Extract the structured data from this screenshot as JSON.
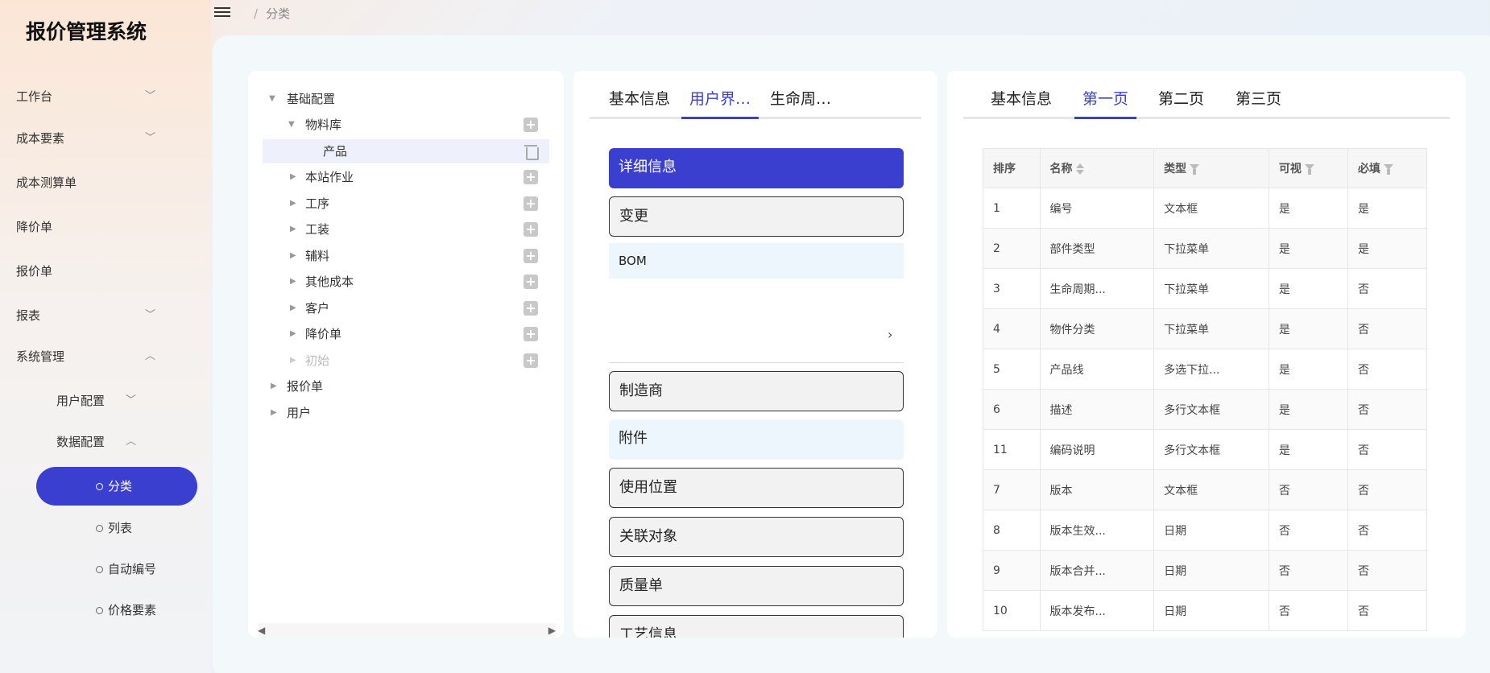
{
  "app": {
    "title": "报价管理系统"
  },
  "breadcrumb": {
    "separator": "/",
    "current": "分类"
  },
  "sidebar": {
    "items": [
      {
        "label": "工作台",
        "chevron": "down"
      },
      {
        "label": "成本要素",
        "chevron": "down"
      },
      {
        "label": "成本测算单"
      },
      {
        "label": "降价单"
      },
      {
        "label": "报价单"
      },
      {
        "label": "报表",
        "chevron": "down"
      },
      {
        "label": "系统管理",
        "chevron": "up"
      }
    ],
    "sub": [
      {
        "label": "用户配置",
        "chevron": "down"
      },
      {
        "label": "数据配置",
        "chevron": "up"
      }
    ],
    "leaves": [
      {
        "label": "分类",
        "active": true
      },
      {
        "label": "列表"
      },
      {
        "label": "自动编号"
      },
      {
        "label": "价格要素"
      }
    ]
  },
  "tree": {
    "nodes": [
      {
        "label": "基础配置",
        "level": 0,
        "arrow": "down"
      },
      {
        "label": "物料库",
        "level": 1,
        "arrow": "down",
        "add": true
      },
      {
        "label": "产品",
        "level": 2,
        "selected": true,
        "trash": true
      },
      {
        "label": "本站作业",
        "level": 1,
        "arrow": "right",
        "add": true
      },
      {
        "label": "工序",
        "level": 1,
        "arrow": "right",
        "add": true
      },
      {
        "label": "工装",
        "level": 1,
        "arrow": "right",
        "add": true
      },
      {
        "label": "辅料",
        "level": 1,
        "arrow": "right",
        "add": true
      },
      {
        "label": "其他成本",
        "level": 1,
        "arrow": "right",
        "add": true
      },
      {
        "label": "客户",
        "level": 1,
        "arrow": "right",
        "add": true
      },
      {
        "label": "降价单",
        "level": 1,
        "arrow": "right",
        "add": true
      },
      {
        "label": "初始",
        "level": 1,
        "arrow": "right",
        "add": true,
        "disabled": true
      },
      {
        "label": "报价单",
        "level": 0,
        "arrow": "right"
      },
      {
        "label": "用户",
        "level": 0,
        "arrow": "right"
      }
    ]
  },
  "middle": {
    "tabs": [
      "基本信息",
      "用户界…",
      "生命周…"
    ],
    "active_tab": 1,
    "sections": {
      "details": "详细信息",
      "change": "变更",
      "bom": "BOM",
      "manufacturer": "制造商",
      "attachment": "附件",
      "usage": "使用位置",
      "related": "关联对象",
      "quality": "质量单",
      "process": "工艺信息"
    }
  },
  "right": {
    "tabs": [
      "基本信息",
      "第一页",
      "第二页",
      "第三页"
    ],
    "active_tab": 1,
    "table": {
      "headers": [
        "排序",
        "名称",
        "类型",
        "可视",
        "必填"
      ],
      "rows": [
        [
          "1",
          "编号",
          "文本框",
          "是",
          "是"
        ],
        [
          "2",
          "部件类型",
          "下拉菜单",
          "是",
          "是"
        ],
        [
          "3",
          "生命周期...",
          "下拉菜单",
          "是",
          "否"
        ],
        [
          "4",
          "物件分类",
          "下拉菜单",
          "是",
          "否"
        ],
        [
          "5",
          "产品线",
          "多选下拉...",
          "是",
          "否"
        ],
        [
          "6",
          "描述",
          "多行文本框",
          "是",
          "否"
        ],
        [
          "11",
          "编码说明",
          "多行文本框",
          "是",
          "否"
        ],
        [
          "7",
          "版本",
          "文本框",
          "否",
          "否"
        ],
        [
          "8",
          "版本生效...",
          "日期",
          "否",
          "否"
        ],
        [
          "9",
          "版本合并...",
          "日期",
          "否",
          "否"
        ],
        [
          "10",
          "版本发布...",
          "日期",
          "否",
          "否"
        ]
      ]
    }
  },
  "colors": {
    "accent": "#3a3fd0"
  }
}
